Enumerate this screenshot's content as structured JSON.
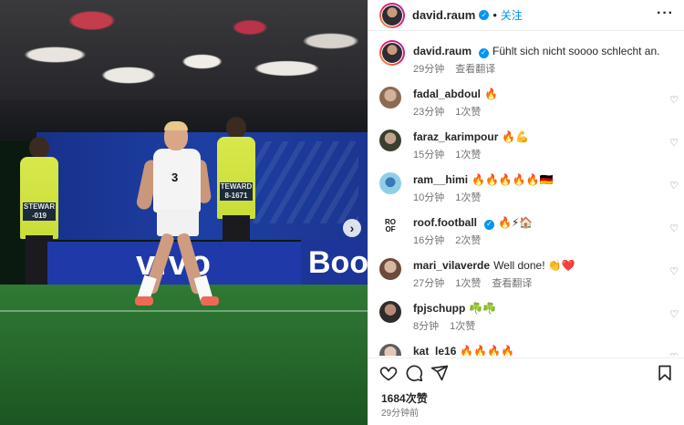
{
  "header": {
    "username": "david.raum",
    "follow_label": "关注",
    "separator": "•",
    "more_label": "···"
  },
  "photo": {
    "steward_tag_1": "STEWAR\n-019",
    "steward_tag_2": "TEWARD\n8-1671",
    "board_left_text": "vivo",
    "board_right_text": "Boo",
    "jersey_number": "3",
    "next_button": "›"
  },
  "caption": {
    "username": "david.raum",
    "text": "Fühlt sich nicht soooo schlecht an...😮‍💨🇩🇪⚡",
    "time": "29分钟",
    "translate_label": "查看翻译"
  },
  "comments": [
    {
      "username": "fadal_abdoul",
      "text": "🔥",
      "time": "23分钟",
      "likes": "1次赞",
      "extra": "",
      "verified": false
    },
    {
      "username": "faraz_karimpour",
      "text": "🔥💪",
      "time": "15分钟",
      "likes": "1次赞",
      "extra": "",
      "verified": false
    },
    {
      "username": "ram__himi",
      "text": "🔥🔥🔥🔥🔥🇩🇪",
      "time": "10分钟",
      "likes": "1次赞",
      "extra": "",
      "verified": false
    },
    {
      "username": "roof.football",
      "text": "🔥⚡🏠",
      "time": "16分钟",
      "likes": "2次赞",
      "extra": "",
      "verified": true
    },
    {
      "username": "mari_vilaverde",
      "text": "Well done! 👏❤️",
      "time": "27分钟",
      "likes": "1次赞",
      "extra": "查看翻译",
      "verified": false
    },
    {
      "username": "fpjschupp",
      "text": "☘️☘️",
      "time": "8分钟",
      "likes": "1次赞",
      "extra": "",
      "verified": false
    },
    {
      "username": "kat_le16",
      "text": "🔥🔥🔥🔥",
      "time": "",
      "likes": "",
      "extra": "",
      "verified": false
    }
  ],
  "roof_avatar_text": "RO\nOF",
  "footer": {
    "likes": "1684次赞",
    "time": "29分钟前"
  },
  "icons": {
    "heart": "heart-icon",
    "comment": "comment-icon",
    "share": "share-icon",
    "save": "bookmark-icon",
    "verified": "verified-badge-icon"
  },
  "colors": {
    "link": "#0095f6",
    "muted": "#737373",
    "text": "#262626"
  }
}
